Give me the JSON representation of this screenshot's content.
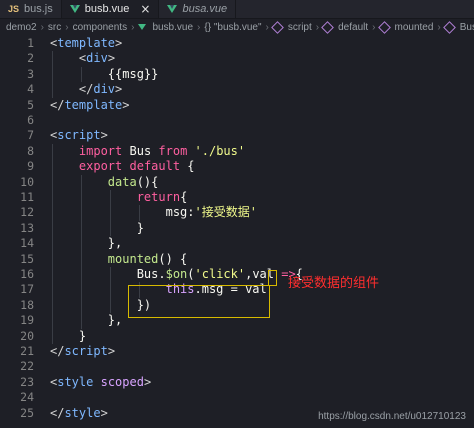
{
  "tabs": [
    {
      "label": "bus.js",
      "icon": "js-icon"
    },
    {
      "label": "busb.vue",
      "icon": "vue-icon",
      "active": true
    },
    {
      "label": "busa.vue",
      "icon": "vue-icon",
      "italic": true
    }
  ],
  "breadcrumb": [
    "demo2",
    "src",
    "components",
    "busb.vue",
    "{} \"busb.vue\"",
    "script",
    "default",
    "mounted",
    "Bus.$on('click')"
  ],
  "colors": {
    "keyword": "#ff5fa0",
    "tag": "#7fb8ff",
    "string": "#f1fa8c",
    "function": "#c3e88d",
    "annotation": "#ff2e2e",
    "highlight_border": "#d7ba00"
  },
  "lines": [
    {
      "n": "1",
      "tokens": [
        [
          "punct",
          "<"
        ],
        [
          "tag",
          "template"
        ],
        [
          "punct",
          ">"
        ]
      ]
    },
    {
      "n": "2",
      "tokens": [
        [
          "plain",
          "    "
        ],
        [
          "punct",
          "<"
        ],
        [
          "tag",
          "div"
        ],
        [
          "punct",
          ">"
        ]
      ]
    },
    {
      "n": "3",
      "tokens": [
        [
          "plain",
          "        {{msg}}"
        ]
      ]
    },
    {
      "n": "4",
      "tokens": [
        [
          "plain",
          "    "
        ],
        [
          "punct",
          "</"
        ],
        [
          "tag",
          "div"
        ],
        [
          "punct",
          ">"
        ]
      ]
    },
    {
      "n": "5",
      "tokens": [
        [
          "punct",
          "</"
        ],
        [
          "tag",
          "template"
        ],
        [
          "punct",
          ">"
        ]
      ]
    },
    {
      "n": "6",
      "tokens": []
    },
    {
      "n": "7",
      "tokens": [
        [
          "punct",
          "<"
        ],
        [
          "tag",
          "script"
        ],
        [
          "punct",
          ">"
        ]
      ]
    },
    {
      "n": "8",
      "tokens": [
        [
          "plain",
          "    "
        ],
        [
          "kw",
          "import"
        ],
        [
          "plain",
          " Bus "
        ],
        [
          "kw",
          "from"
        ],
        [
          "plain",
          " "
        ],
        [
          "str",
          "'./bus'"
        ]
      ]
    },
    {
      "n": "9",
      "tokens": [
        [
          "plain",
          "    "
        ],
        [
          "kw",
          "export"
        ],
        [
          "plain",
          " "
        ],
        [
          "kw",
          "default"
        ],
        [
          "plain",
          " {"
        ]
      ]
    },
    {
      "n": "10",
      "tokens": [
        [
          "plain",
          "        "
        ],
        [
          "fn",
          "data"
        ],
        [
          "plain",
          "(){"
        ]
      ]
    },
    {
      "n": "11",
      "tokens": [
        [
          "plain",
          "            "
        ],
        [
          "kw",
          "return"
        ],
        [
          "plain",
          "{"
        ]
      ]
    },
    {
      "n": "12",
      "tokens": [
        [
          "plain",
          "                msg:"
        ],
        [
          "str",
          "'接受数据'"
        ]
      ]
    },
    {
      "n": "13",
      "tokens": [
        [
          "plain",
          "            }"
        ]
      ]
    },
    {
      "n": "14",
      "tokens": [
        [
          "plain",
          "        },"
        ]
      ]
    },
    {
      "n": "15",
      "tokens": [
        [
          "plain",
          "        "
        ],
        [
          "fn",
          "mounted"
        ],
        [
          "plain",
          "() {"
        ]
      ]
    },
    {
      "n": "16",
      "tokens": [
        [
          "plain",
          "            Bus."
        ],
        [
          "fn",
          "$on"
        ],
        [
          "plain",
          "("
        ],
        [
          "str",
          "'click'"
        ],
        [
          "plain",
          ",val "
        ],
        [
          "kw",
          "=>"
        ],
        [
          "plain",
          "{"
        ]
      ]
    },
    {
      "n": "17",
      "tokens": [
        [
          "plain",
          "                "
        ],
        [
          "attr",
          "this"
        ],
        [
          "plain",
          ".msg = val"
        ]
      ]
    },
    {
      "n": "18",
      "tokens": [
        [
          "plain",
          "            })"
        ]
      ]
    },
    {
      "n": "19",
      "tokens": [
        [
          "plain",
          "        },"
        ]
      ]
    },
    {
      "n": "20",
      "tokens": [
        [
          "plain",
          "    }"
        ]
      ]
    },
    {
      "n": "21",
      "tokens": [
        [
          "punct",
          "</"
        ],
        [
          "tag",
          "script"
        ],
        [
          "punct",
          ">"
        ]
      ]
    },
    {
      "n": "22",
      "tokens": []
    },
    {
      "n": "23",
      "tokens": [
        [
          "punct",
          "<"
        ],
        [
          "tag",
          "style"
        ],
        [
          "plain",
          " "
        ],
        [
          "attr",
          "scoped"
        ],
        [
          "punct",
          ">"
        ]
      ]
    },
    {
      "n": "24",
      "tokens": []
    },
    {
      "n": "25",
      "tokens": [
        [
          "punct",
          "</"
        ],
        [
          "tag",
          "style"
        ],
        [
          "punct",
          ">"
        ]
      ]
    }
  ],
  "annotation": "接受数据的组件",
  "watermark": "https://blog.csdn.net/u012710123"
}
